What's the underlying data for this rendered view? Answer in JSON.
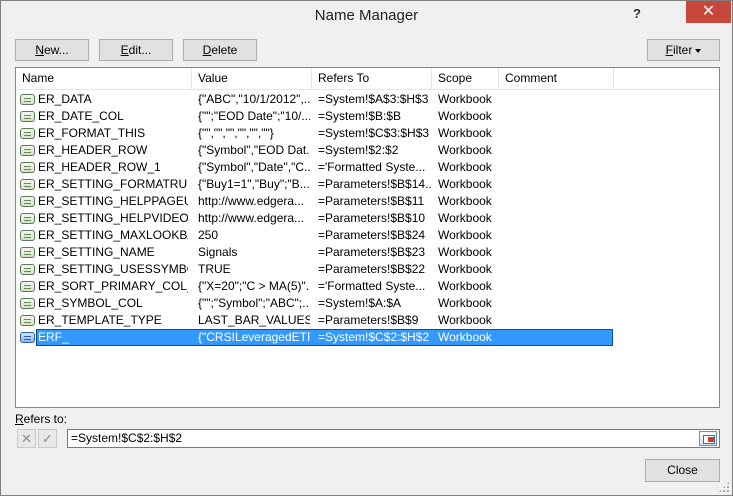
{
  "window": {
    "title": "Name Manager",
    "help_label": "?",
    "close_label": "✕"
  },
  "toolbar": {
    "new_prefix": "N",
    "new_rest": "ew...",
    "edit_prefix": "E",
    "edit_rest": "dit...",
    "delete_prefix": "D",
    "delete_rest": "elete",
    "filter_prefix": "F",
    "filter_rest": "ilter"
  },
  "columns": [
    "Name",
    "Value",
    "Refers To",
    "Scope",
    "Comment"
  ],
  "rows": [
    {
      "name": "ER_DATA",
      "value": "{\"ABC\",\"10/1/2012\",...",
      "refers": "=System!$A$3:$H$3",
      "scope": "Workbook",
      "comment": ""
    },
    {
      "name": "ER_DATE_COL",
      "value": "{\"\";\"EOD Date\";\"10/...",
      "refers": "=System!$B:$B",
      "scope": "Workbook",
      "comment": ""
    },
    {
      "name": "ER_FORMAT_THIS",
      "value": "{\"\",\"\",\"\",\"\",\"\",\"\"}",
      "refers": "=System!$C$3:$H$3",
      "scope": "Workbook",
      "comment": ""
    },
    {
      "name": "ER_HEADER_ROW",
      "value": "{\"Symbol\",\"EOD Dat...",
      "refers": "=System!$2:$2",
      "scope": "Workbook",
      "comment": ""
    },
    {
      "name": "ER_HEADER_ROW_1",
      "value": "{\"Symbol\",\"Date\",\"C...",
      "refers": "='Formatted Syste...",
      "scope": "Workbook",
      "comment": ""
    },
    {
      "name": "ER_SETTING_FORMATRULES",
      "value": "{\"Buy1=1\",\"Buy\";\"B...",
      "refers": "=Parameters!$B$14...",
      "scope": "Workbook",
      "comment": ""
    },
    {
      "name": "ER_SETTING_HELPPAGEURL",
      "value": "http://www.edgera...",
      "refers": "=Parameters!$B$11",
      "scope": "Workbook",
      "comment": ""
    },
    {
      "name": "ER_SETTING_HELPVIDEOURL",
      "value": "http://www.edgera...",
      "refers": "=Parameters!$B$10",
      "scope": "Workbook",
      "comment": ""
    },
    {
      "name": "ER_SETTING_MAXLOOKBACK",
      "value": "250",
      "refers": "=Parameters!$B$24",
      "scope": "Workbook",
      "comment": ""
    },
    {
      "name": "ER_SETTING_NAME",
      "value": "Signals",
      "refers": "=Parameters!$B$23",
      "scope": "Workbook",
      "comment": ""
    },
    {
      "name": "ER_SETTING_USESSYMBOLLIST",
      "value": "TRUE",
      "refers": "=Parameters!$B$22",
      "scope": "Workbook",
      "comment": ""
    },
    {
      "name": "ER_SORT_PRIMARY_COL_ASC",
      "value": "{\"X=20\";\"C > MA(5)\"...",
      "refers": "='Formatted Syste...",
      "scope": "Workbook",
      "comment": ""
    },
    {
      "name": "ER_SYMBOL_COL",
      "value": "{\"\";\"Symbol\";\"ABC\";...",
      "refers": "=System!$A:$A",
      "scope": "Workbook",
      "comment": ""
    },
    {
      "name": "ER_TEMPLATE_TYPE",
      "value": "LAST_BAR_VALUES",
      "refers": "=Parameters!$B$9",
      "scope": "Workbook",
      "comment": ""
    },
    {
      "name": "ERF_",
      "value": "{\"CRSILeveragedETF...",
      "refers": "=System!$C$2:$H$2",
      "scope": "Workbook",
      "comment": "",
      "selected": true
    }
  ],
  "refers_to": {
    "label_prefix": "R",
    "label_rest": "efers to:",
    "value": "=System!$C$2:$H$2",
    "cancel_icon": "✕",
    "ok_icon": "✓"
  },
  "footer": {
    "close_label": "Close"
  }
}
